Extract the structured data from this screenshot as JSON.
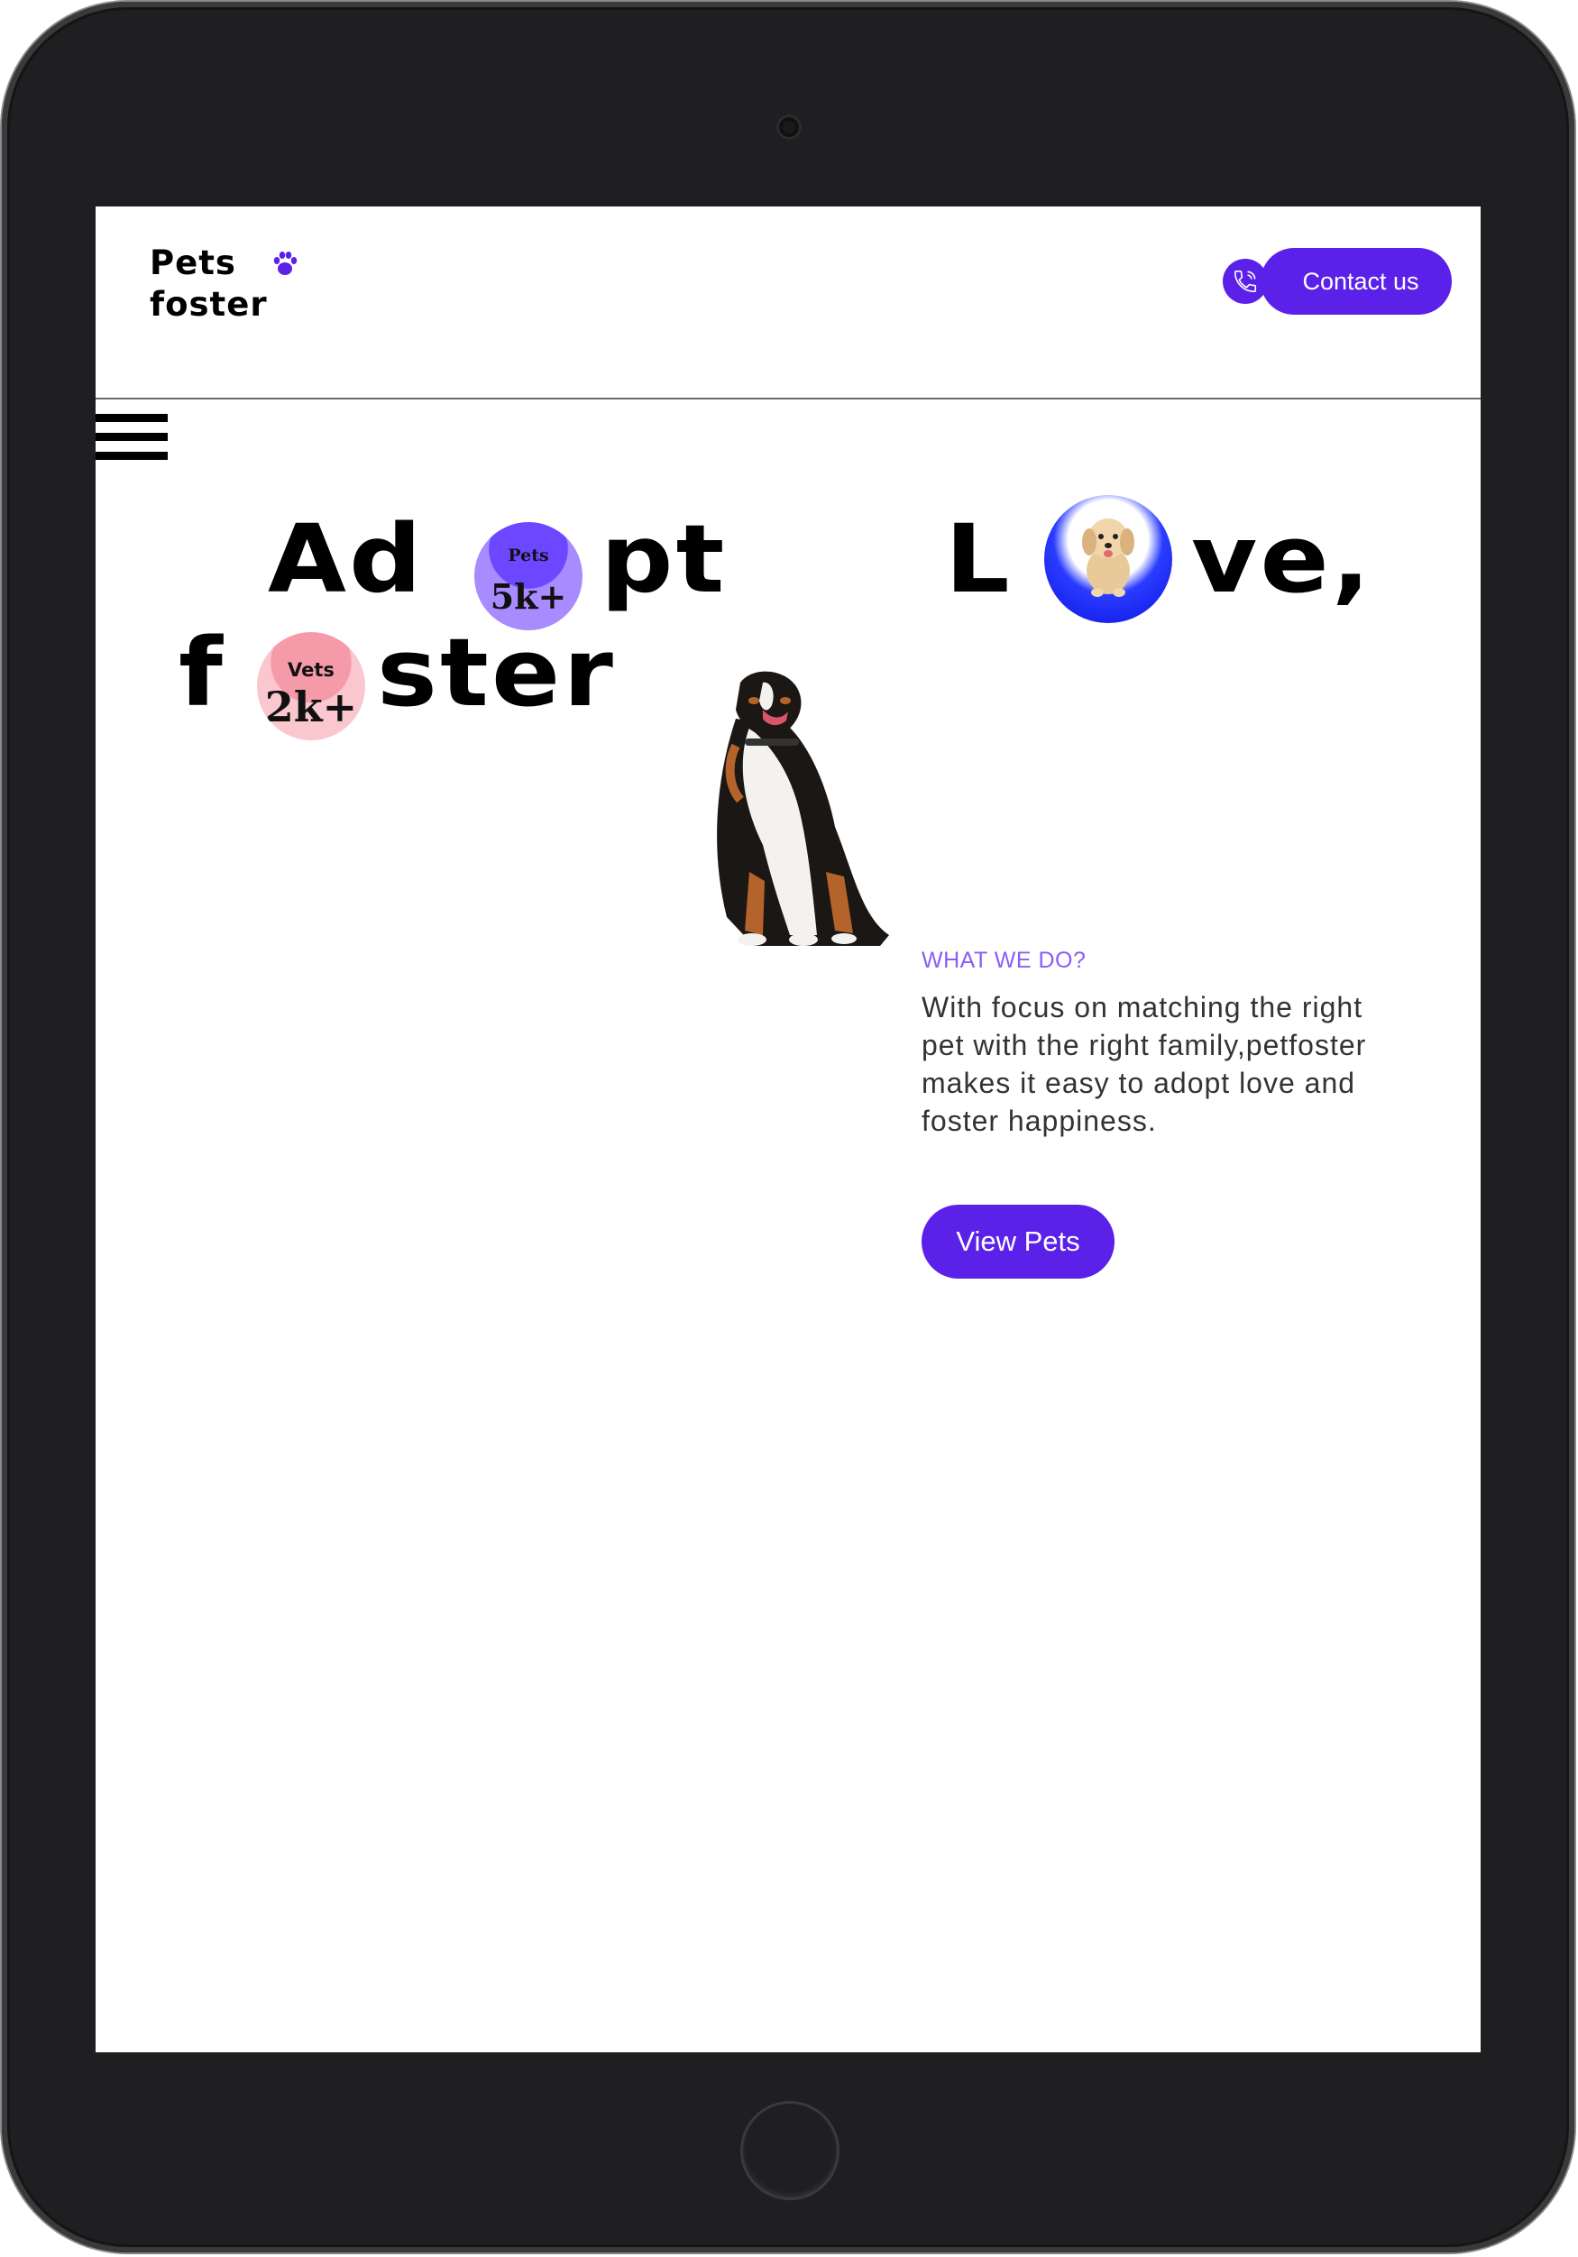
{
  "brand": {
    "line1": "Pets",
    "line2": "foster"
  },
  "header": {
    "contact_label": "Contact us"
  },
  "hero": {
    "word_adopt_left": "Ad",
    "word_adopt_right": "pt",
    "word_love_left": "L",
    "word_love_right": "ve,",
    "word_foster_left": "f",
    "word_foster_right": "ster",
    "word_happiness": "happiness.",
    "pets_badge": {
      "label": "Pets",
      "value": "5k+"
    },
    "vets_badge": {
      "label": "Vets",
      "value": "2k+"
    }
  },
  "what_we_do": {
    "title": "WHAT WE DO?",
    "body": "With focus on matching the right pet with the right family,petfoster makes it easy to adopt love and foster happiness.",
    "button_label": "View Pets"
  },
  "colors": {
    "accent": "#5b21e8",
    "accent_light": "#8b5cf6",
    "pets_badge": "#a88cff",
    "vets_badge": "#fbc7cf",
    "love_o": "#0a12e0"
  }
}
